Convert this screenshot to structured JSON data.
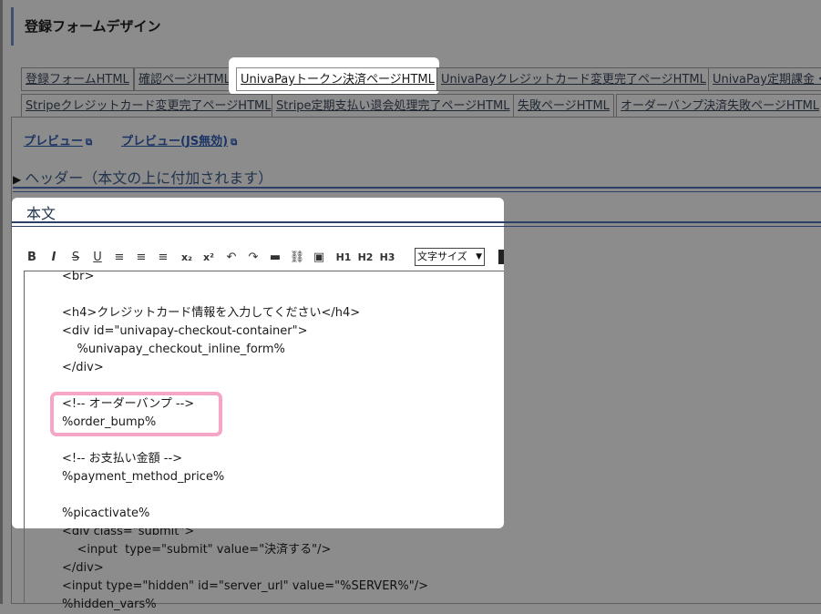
{
  "page_title": "登録フォームデザイン",
  "tabs": [
    {
      "label": "登録フォームHTML"
    },
    {
      "label": "確認ページHTML"
    },
    {
      "label": "UnivaPayトークン決済ページHTML"
    },
    {
      "label": "UnivaPayクレジットカード変更完了ページHTML"
    },
    {
      "label": "UnivaPay定期課金・"
    },
    {
      "label": "Stripeクレジットカード変更完了ページHTML"
    },
    {
      "label": "Stripe定期支払い退会処理完了ページHTML"
    },
    {
      "label": "失敗ページHTML"
    },
    {
      "label": "オーダーバンプ決済失敗ページHTML"
    }
  ],
  "links": {
    "preview": "プレビュー",
    "preview_nojs": "プレビュー(JS無効)"
  },
  "header_section": "ヘッダー（本文の上に付加されます）",
  "body_section": "本文",
  "toolbar": {
    "bold": "B",
    "italic": "I",
    "strike": "S",
    "underline": "U",
    "sub": "x₂",
    "sup": "x²",
    "h1": "H1",
    "h2": "H2",
    "h3": "H3",
    "font_size": "文字サイズ"
  },
  "code": [
    "<br>",
    "",
    "<h4>クレジットカード情報を入力してください</h4>",
    "<div id=\"univapay-checkout-container\">",
    "    %univapay_checkout_inline_form%",
    "</div>",
    "",
    "<!-- オーダーバンプ -->",
    "%order_bump%",
    "",
    "<!-- お支払い金額 -->",
    "%payment_method_price%",
    "",
    "%picactivate%",
    "<div class=\"submit\">",
    "    <input  type=\"submit\" value=\"決済する\"/>",
    "</div>",
    "<input type=\"hidden\" id=\"server_url\" value=\"%SERVER%\"/>",
    "%hidden_vars%"
  ]
}
